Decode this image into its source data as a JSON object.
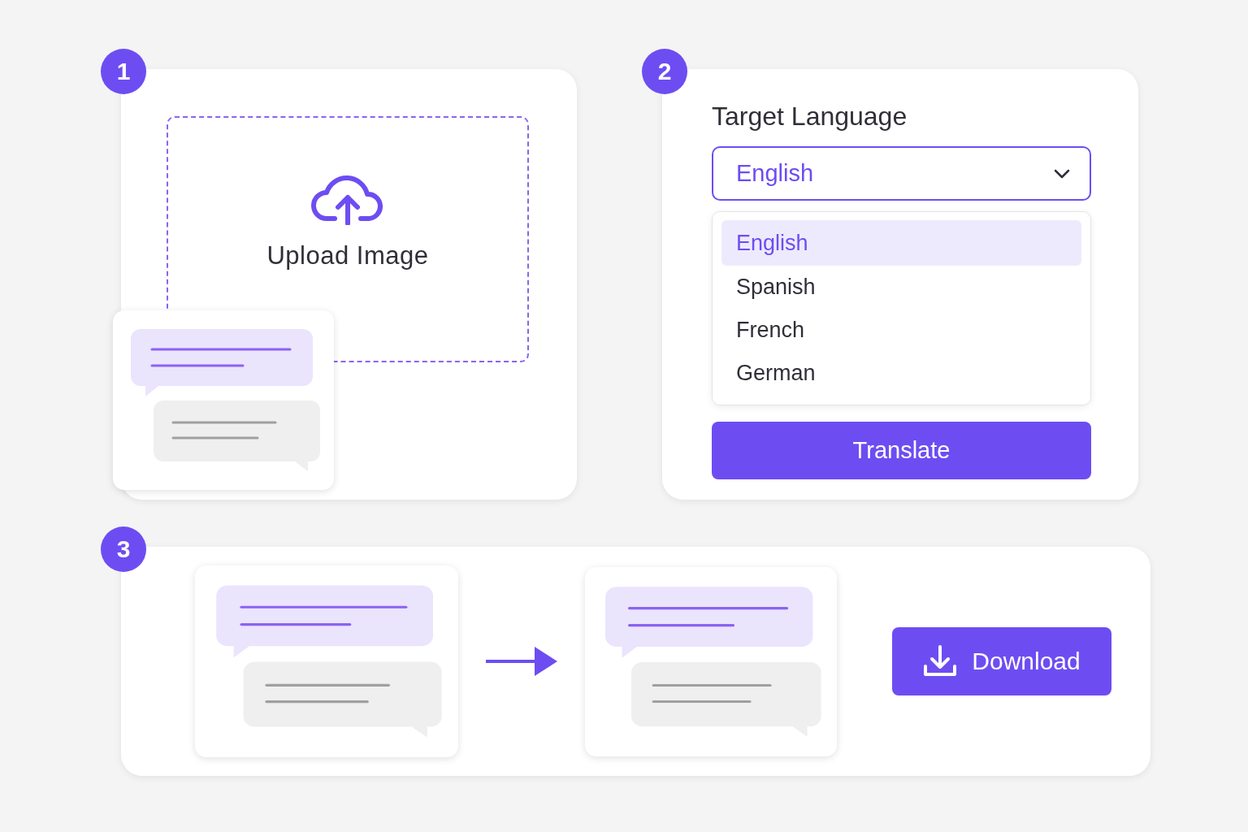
{
  "upload": {
    "badge": "1",
    "label": "Upload Image"
  },
  "language": {
    "badge": "2",
    "title": "Target Language",
    "value": "English",
    "options": [
      {
        "label": "English",
        "selected": true
      },
      {
        "label": "Spanish",
        "selected": false
      },
      {
        "label": "French",
        "selected": false
      },
      {
        "label": "German",
        "selected": false
      }
    ],
    "button": "Translate"
  },
  "result": {
    "badge": "3",
    "button": "Download"
  }
}
